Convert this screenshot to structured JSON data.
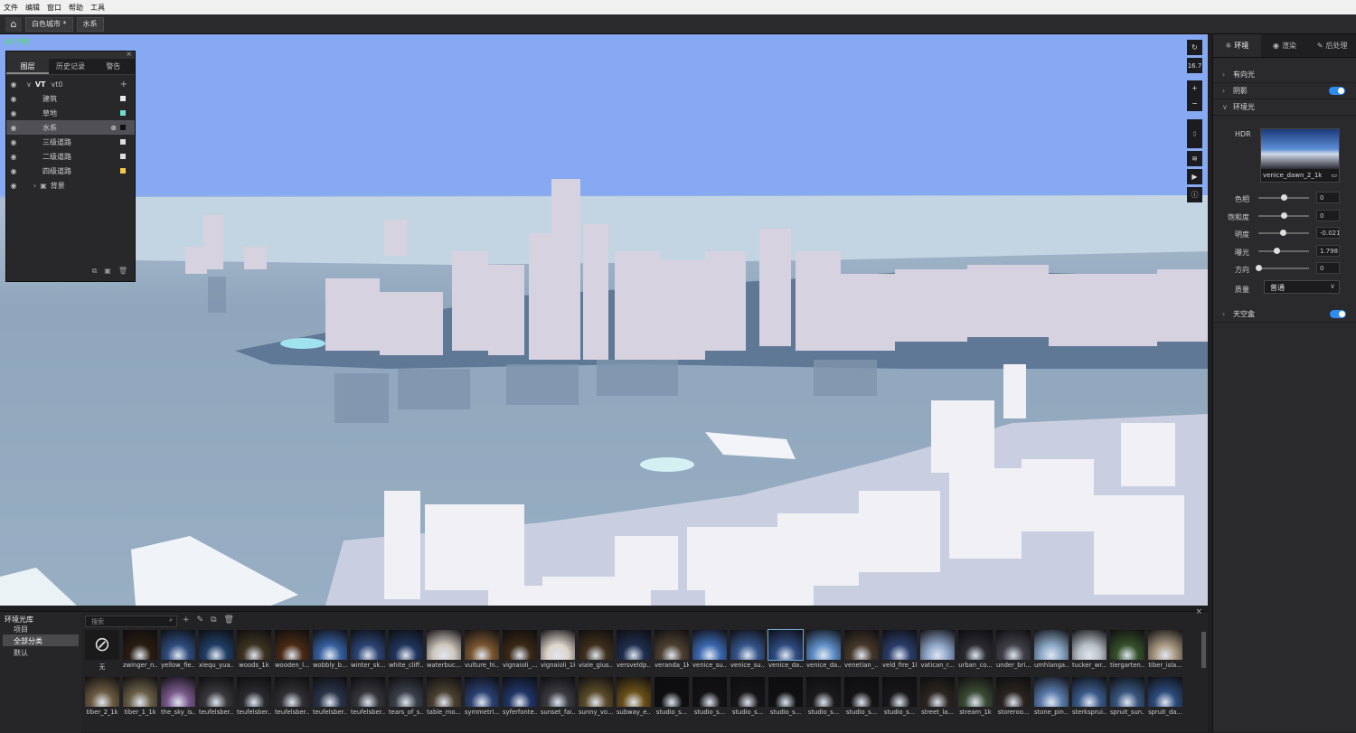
{
  "menu": [
    "文件",
    "编辑",
    "窗口",
    "帮助",
    "工具"
  ],
  "tabs": {
    "home": "⌂",
    "doc1": "白色城市 *",
    "doc2": "水系"
  },
  "viewport": {
    "fps": "60 FPS",
    "zoom": "16.7",
    "ctrl": {
      "refresh": "↻",
      "plus": "+",
      "minus": "−",
      "wifi": "≋",
      "play": "▶",
      "info": "ⓘ"
    }
  },
  "layers": {
    "tabs": [
      "图层",
      "历史记录",
      "警告"
    ],
    "close": "×",
    "root": {
      "name": "VT",
      "sub": "vt0",
      "add": "+"
    },
    "items": [
      {
        "label": "建筑",
        "color": "#e8e8e8"
      },
      {
        "label": "草地",
        "color": "#6fe0c8"
      },
      {
        "label": "水系",
        "color": "#111111",
        "selected": true,
        "icon": "⊗"
      },
      {
        "label": "三级道路",
        "color": "#dddddd"
      },
      {
        "label": "二级道路",
        "color": "#dddddd"
      },
      {
        "label": "四级道路",
        "color": "#f2c84b"
      }
    ],
    "bg": "背景",
    "footer": [
      "⧉",
      "▣",
      "🗑"
    ]
  },
  "right": {
    "tabs": [
      {
        "label": "环境",
        "icon": "☼"
      },
      {
        "label": "渲染",
        "icon": "◉"
      },
      {
        "label": "后处理",
        "icon": "✎"
      }
    ],
    "sections": {
      "directional": "有向光",
      "shadow": "阴影",
      "ambient": "环境光",
      "skybox": "天空盒"
    },
    "hdr": {
      "label": "HDR",
      "name": "venice_dawn_2_1k",
      "folder": "▭"
    },
    "props": [
      {
        "label": "色相",
        "value": "0",
        "pos": 0.5
      },
      {
        "label": "饱和度",
        "value": "0",
        "pos": 0.5
      },
      {
        "label": "明度",
        "value": "-0.021",
        "pos": 0.49
      },
      {
        "label": "曝光",
        "value": "1.798",
        "pos": 0.35
      },
      {
        "label": "方向",
        "value": "0",
        "pos": 0.0
      }
    ],
    "quality": {
      "label": "质量",
      "value": "普通",
      "chev": "∨"
    }
  },
  "library": {
    "title": "环境光库",
    "cats": [
      "项目",
      "全部分类",
      "默认"
    ],
    "selected_cat": 1,
    "search": "搜索",
    "tools": [
      "+",
      "✎",
      "⧉",
      "🗑"
    ],
    "close": "×",
    "row1": [
      {
        "n": "无",
        "c": "#1a1a1a"
      },
      {
        "n": "zwinger_n...",
        "c": "#2a1c10"
      },
      {
        "n": "yellow_fie...",
        "c": "#2e4c7e"
      },
      {
        "n": "xiequ_yua...",
        "c": "#1f3d64"
      },
      {
        "n": "woods_1k",
        "c": "#3d3320"
      },
      {
        "n": "wooden_l...",
        "c": "#4a2a14"
      },
      {
        "n": "wobbly_b...",
        "c": "#355f9e"
      },
      {
        "n": "winter_sk...",
        "c": "#2b4372"
      },
      {
        "n": "white_cliff...",
        "c": "#20355c"
      },
      {
        "n": "waterbuc...",
        "c": "#d0c8bd"
      },
      {
        "n": "vulture_hi...",
        "c": "#7a5530"
      },
      {
        "n": "vignaioli_...",
        "c": "#3a2814"
      },
      {
        "n": "vignaioli_1k",
        "c": "#ddd5cb"
      },
      {
        "n": "viale_gius...",
        "c": "#3f2f1c"
      },
      {
        "n": "versveldp...",
        "c": "#1e2e4e"
      },
      {
        "n": "veranda_1k",
        "c": "#4d4030"
      },
      {
        "n": "venice_su...",
        "c": "#3b68b0"
      },
      {
        "n": "venice_su...",
        "c": "#35548a"
      },
      {
        "n": "venice_da...",
        "c": "#2d4a80",
        "sel": true
      },
      {
        "n": "venice_da...",
        "c": "#5d8ec8"
      },
      {
        "n": "venetian_...",
        "c": "#46382a"
      },
      {
        "n": "veld_fire_1k",
        "c": "#2a3d6a"
      },
      {
        "n": "vatican_r...",
        "c": "#8fa6c9"
      },
      {
        "n": "urban_co...",
        "c": "#2a2a30"
      },
      {
        "n": "under_bri...",
        "c": "#404048"
      },
      {
        "n": "umhlanga...",
        "c": "#8aa8c6"
      },
      {
        "n": "tucker_wr...",
        "c": "#b8c0c8"
      },
      {
        "n": "tiergarten...",
        "c": "#36502a"
      },
      {
        "n": "tiber_isla...",
        "c": "#a99880"
      }
    ],
    "row2": [
      {
        "n": "tiber_2_1k",
        "c": "#6b5a40"
      },
      {
        "n": "tiber_1_1k",
        "c": "#6a6048"
      },
      {
        "n": "the_sky_is...",
        "c": "#7a5a8c"
      },
      {
        "n": "teufelsber...",
        "c": "#38383c"
      },
      {
        "n": "teufelsber...",
        "c": "#2a2a2e"
      },
      {
        "n": "teufelsber...",
        "c": "#303034"
      },
      {
        "n": "teufelsber...",
        "c": "#2a3348"
      },
      {
        "n": "teufelsber...",
        "c": "#34343a"
      },
      {
        "n": "tears_of_s...",
        "c": "#3a3e48"
      },
      {
        "n": "table_mo...",
        "c": "#4a4030"
      },
      {
        "n": "symmetri...",
        "c": "#2a4070"
      },
      {
        "n": "syferfonte...",
        "c": "#1f3566"
      },
      {
        "n": "sunset_fai...",
        "c": "#3a3a40"
      },
      {
        "n": "sunny_vo...",
        "c": "#5a4a28"
      },
      {
        "n": "subway_e...",
        "c": "#6a5018"
      },
      {
        "n": "studio_s...",
        "c": "#0e0e10"
      },
      {
        "n": "studio_s...",
        "c": "#121214"
      },
      {
        "n": "studio_s...",
        "c": "#151518"
      },
      {
        "n": "studio_s...",
        "c": "#101012"
      },
      {
        "n": "studio_s...",
        "c": "#1a1a1c"
      },
      {
        "n": "studio_s...",
        "c": "#141416"
      },
      {
        "n": "studio_s...",
        "c": "#171719"
      },
      {
        "n": "street_la...",
        "c": "#2a2520"
      },
      {
        "n": "stream_1k",
        "c": "#3a4a34"
      },
      {
        "n": "storeroo...",
        "c": "#2a2420"
      },
      {
        "n": "stone_pin...",
        "c": "#5a7aaa"
      },
      {
        "n": "sterksprui...",
        "c": "#3a5a8a"
      },
      {
        "n": "spruit_sun...",
        "c": "#38557e"
      },
      {
        "n": "spruit_da...",
        "c": "#2b4a7a"
      }
    ]
  }
}
